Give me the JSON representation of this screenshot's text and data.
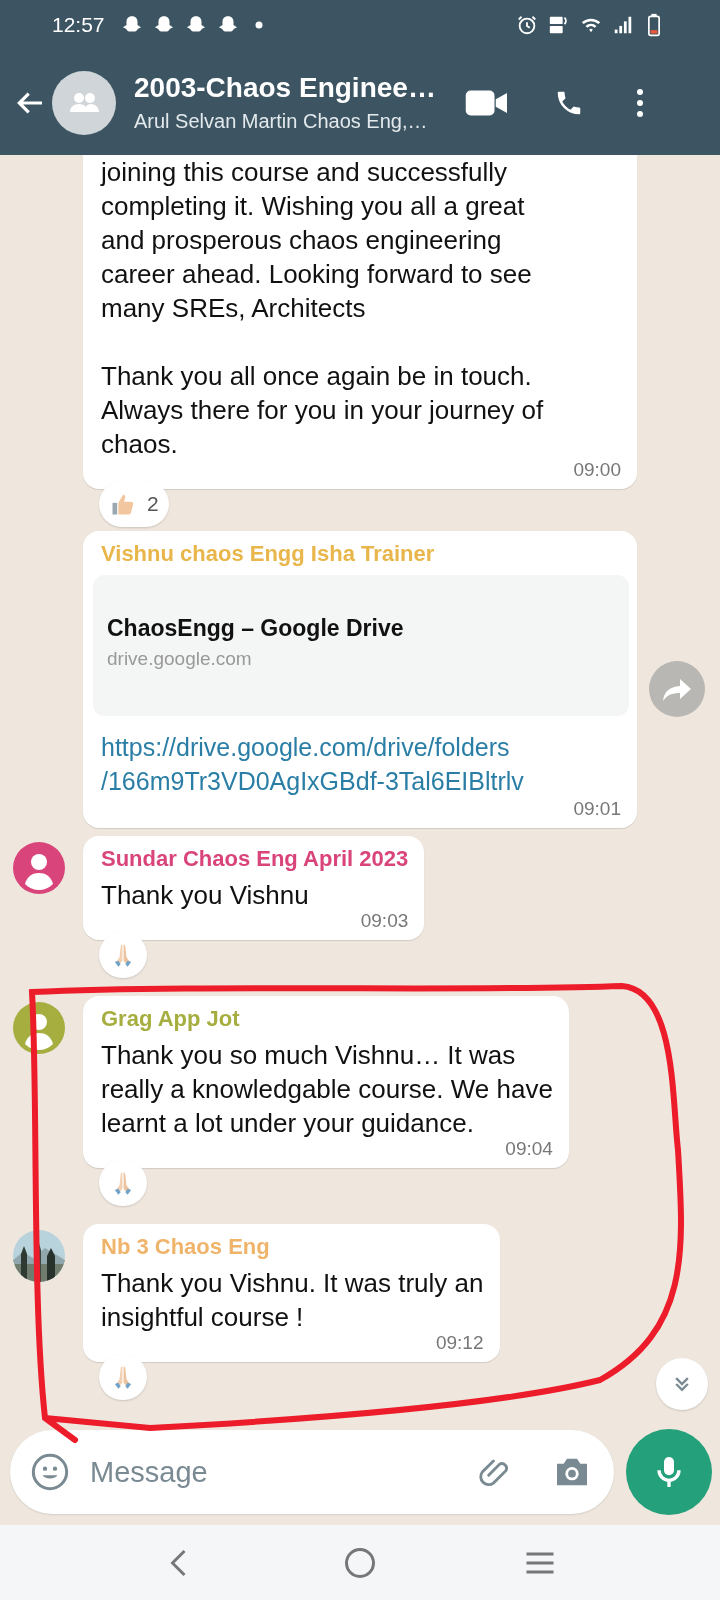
{
  "status_bar": {
    "time": "12:57"
  },
  "header": {
    "title": "2003-Chaos Enginee…",
    "subtitle": "Arul Selvan Martin Chaos Eng,…"
  },
  "messages": [
    {
      "kind": "text",
      "text": "joining this course and successfully\ncompleting it. Wishing you all a great\nand prosperous chaos engineering\ncareer ahead. Looking forward to see\nmany SREs, Architects\n\nThank you all once again be in touch.\nAlways there for you in your journey of\nchaos.",
      "time": "09:00",
      "reaction": {
        "kind": "thumbs-up",
        "count": "2"
      }
    },
    {
      "kind": "link",
      "sender": "Vishnu chaos Engg Isha Trainer",
      "color": "#e8b64a",
      "preview": {
        "title": "ChaosEngg – Google Drive",
        "domain": "drive.google.com"
      },
      "text": "https://drive.google.com/drive/folders\n/166m9Tr3VD0AgIxGBdf-3Tal6EIBltrlv",
      "time": "09:01",
      "share_button": true
    },
    {
      "kind": "text",
      "sender": "Sundar Chaos Eng April 2023",
      "color": "#d9447b",
      "avatar": {
        "kind": "default"
      },
      "text": "Thank you Vishnu",
      "time": "09:03",
      "reaction": {
        "kind": "folded-hands"
      }
    },
    {
      "kind": "text",
      "sender": "Grag App Jot",
      "color": "#a6ae3f",
      "avatar": {
        "kind": "default"
      },
      "text": "Thank you so much Vishnu… It was\nreally a knowledgable course. We have\nlearnt a lot under your guidance.",
      "time": "09:04",
      "reaction": {
        "kind": "folded-hands"
      }
    },
    {
      "kind": "text",
      "sender": "Nb 3 Chaos Eng",
      "color": "#efb36a",
      "text": "Thank you Vishnu. It was truly an\ninsightful course !",
      "time": "09:12",
      "reaction": {
        "kind": "folded-hands"
      }
    }
  ],
  "composer": {
    "placeholder": "Message"
  }
}
